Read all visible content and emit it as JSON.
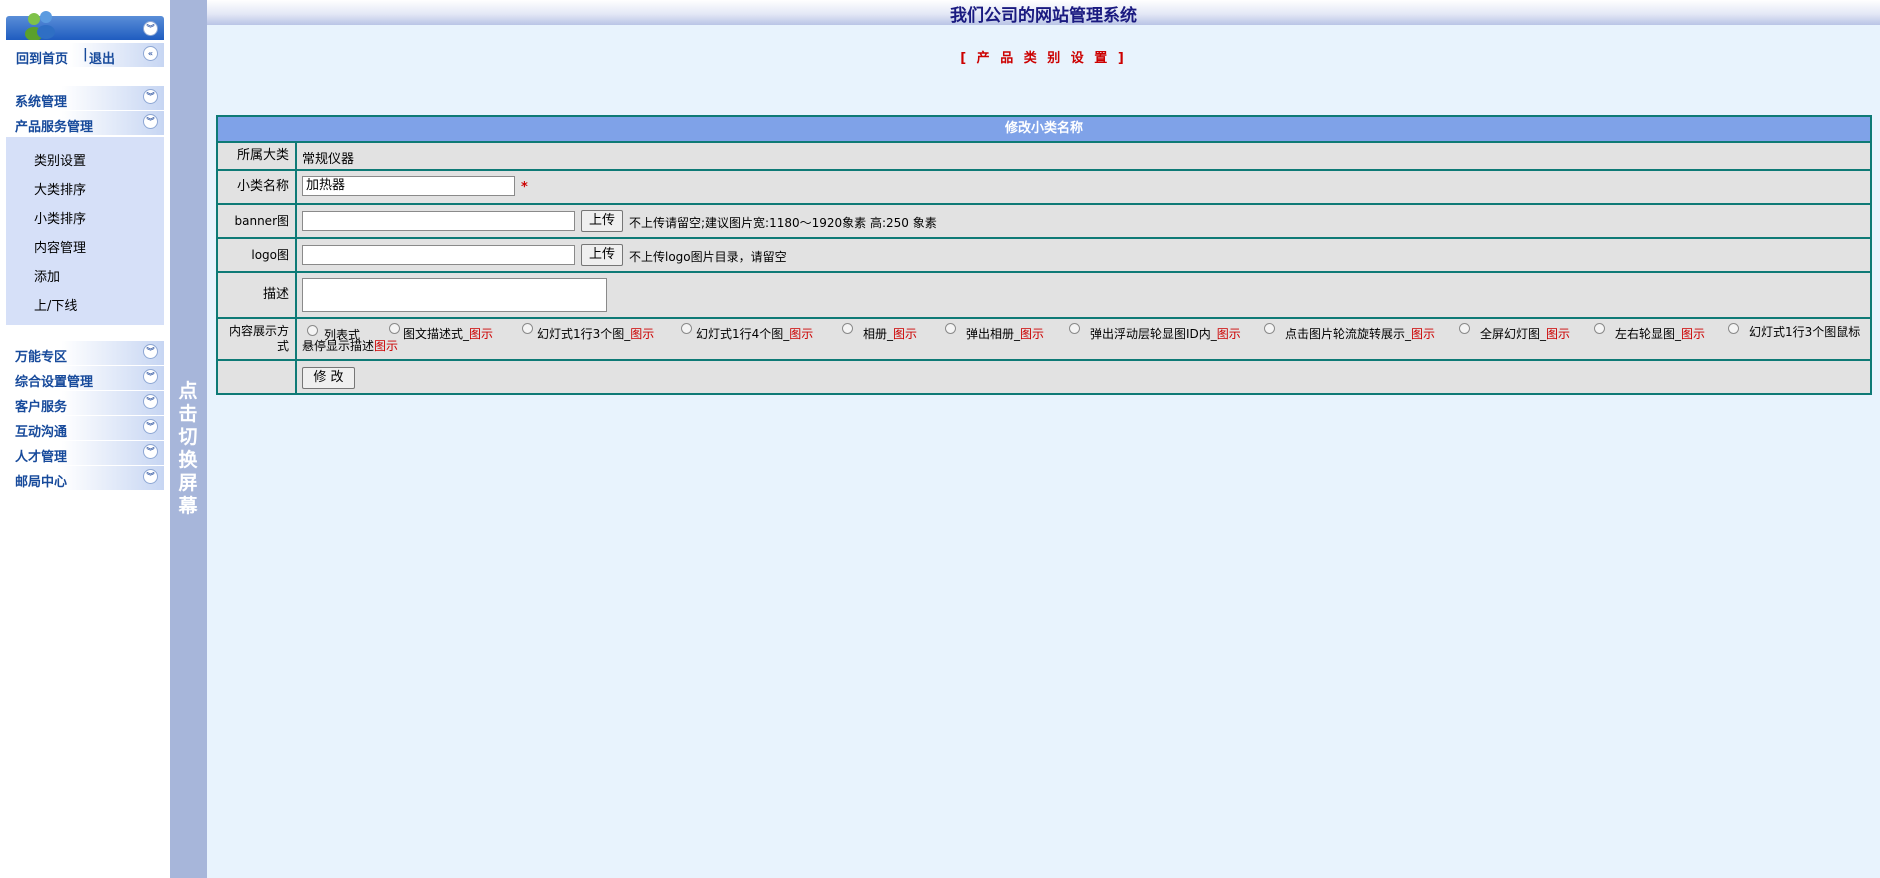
{
  "header": {
    "title": "我们公司的网站管理系统"
  },
  "sidebar": {
    "links": {
      "home": "回到首页",
      "sep": "|",
      "logout": "退出"
    },
    "splitter_text": "点击切换屏幕",
    "menus": [
      {
        "label": "系统管理"
      },
      {
        "label": "产品服务管理"
      }
    ],
    "submenu": [
      {
        "label": "类别设置"
      },
      {
        "label": "大类排序"
      },
      {
        "label": "小类排序"
      },
      {
        "label": "内容管理"
      },
      {
        "label": "添加"
      },
      {
        "label": "上/下线"
      }
    ],
    "menus_bottom": [
      {
        "label": "万能专区"
      },
      {
        "label": "综合设置管理"
      },
      {
        "label": "客户服务"
      },
      {
        "label": "互动沟通"
      },
      {
        "label": "人才管理"
      },
      {
        "label": "邮局中心"
      }
    ]
  },
  "main": {
    "section_title": "[ 产 品 类 别 设 置 ]",
    "form": {
      "header": "修改小类名称",
      "parent_label": "所属大类",
      "parent_value": "常规仪器",
      "name_label": "小类名称",
      "name_value": "加热器",
      "required_mark": "*",
      "banner_label": "banner图",
      "upload_label": "上传",
      "banner_hint": "不上传请留空;建议图片宽:1180～1920象素 高:250 象素",
      "logo_label": "logo图",
      "logo_hint": "不上传logo图片目录，请留空",
      "desc_label": "描述",
      "display_label": "内容展示方式",
      "submit_label": "修 改",
      "options": [
        {
          "label": "列表式",
          "link": ""
        },
        {
          "label": "图文描述式_",
          "link": "图示"
        },
        {
          "label": "幻灯式1行3个图_",
          "link": "图示"
        },
        {
          "label": "幻灯式1行4个图_",
          "link": "图示"
        },
        {
          "label": "相册_",
          "link": "图示"
        },
        {
          "label": "弹出相册_",
          "link": "图示"
        },
        {
          "label": "弹出浮动层轮显图ID内_",
          "link": "图示"
        },
        {
          "label": "点击图片轮流旋转展示_",
          "link": "图示"
        },
        {
          "label": "全屏幻灯图_",
          "link": "图示"
        },
        {
          "label": "左右轮显图_",
          "link": "图示"
        },
        {
          "label": "幻灯式1行3个图鼠标悬停显示描述",
          "link": "图示"
        }
      ]
    }
  }
}
